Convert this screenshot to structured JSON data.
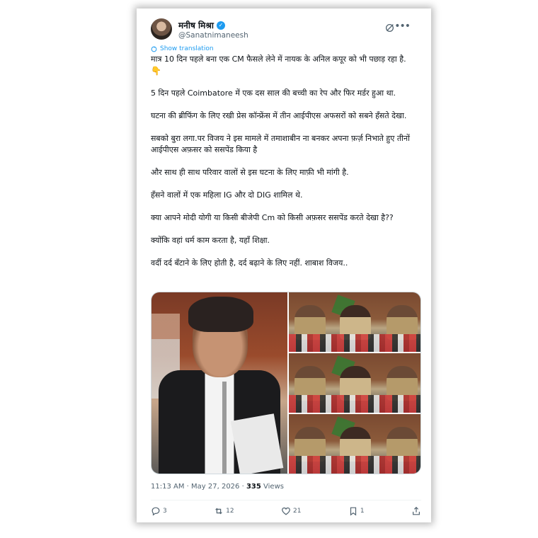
{
  "author": {
    "name": "मनीष मिश्रा",
    "handle": "@Sanatnimaneesh",
    "verified_mark": "✓"
  },
  "translate_label": "Show translation",
  "tweet": {
    "lines": [
      "मात्र 10 दिन पहले बना एक CM फैसले लेने में नायक के अनिल कपूर को भी पछाड़ रहा है.",
      "👇",
      "5 दिन पहले Coimbatore में एक दस साल की बच्ची का रेप और फिर मर्डर हुआ था.",
      "घटना की ब्रीफिंग के लिए रखी प्रेस कॉन्फ्रेंस में तीन आईपीएस अफसरों को सबने हँसते देखा.",
      "सबको बुरा लगा.पर विजय ने इस मामले में तमाशाबीन ना बनकर अपना फ़र्ज़ निभाते हुए तीनों आईपीएस अफ़सर को ससपेंड किया है",
      "और साथ ही साथ परिवार वालों से इस घटना के लिए माफ़ी भी मांगी है.",
      "हँसने वालों में एक महिला IG और दो DIG शामिल थे.",
      "क्या आपने मोदी योगी या किसी बीजेपी Cm को  किसी अफ़सर ससपेंड करते देखा है??",
      "क्योंकि वहां धर्म काम करता है, यहाँ शिक्षा.",
      "वर्दी दर्द बँटाने के लिए होती है, दर्द बढ़ाने के लिए नहीं.  शाबाश विजय.."
    ]
  },
  "meta": {
    "time": "11:13 AM",
    "date": "May 27, 2026",
    "views_count": "335",
    "views_label": "Views"
  },
  "actions": {
    "replies": "3",
    "reposts": "12",
    "likes": "21",
    "bookmarks": "1"
  },
  "colors": {
    "accent": "#1d9bf0",
    "text": "#0f1419",
    "muted": "#536471"
  },
  "icons": [
    "grok-icon",
    "more-icon",
    "translate-icon",
    "reply-icon",
    "repost-icon",
    "like-icon",
    "bookmark-icon",
    "share-icon"
  ]
}
